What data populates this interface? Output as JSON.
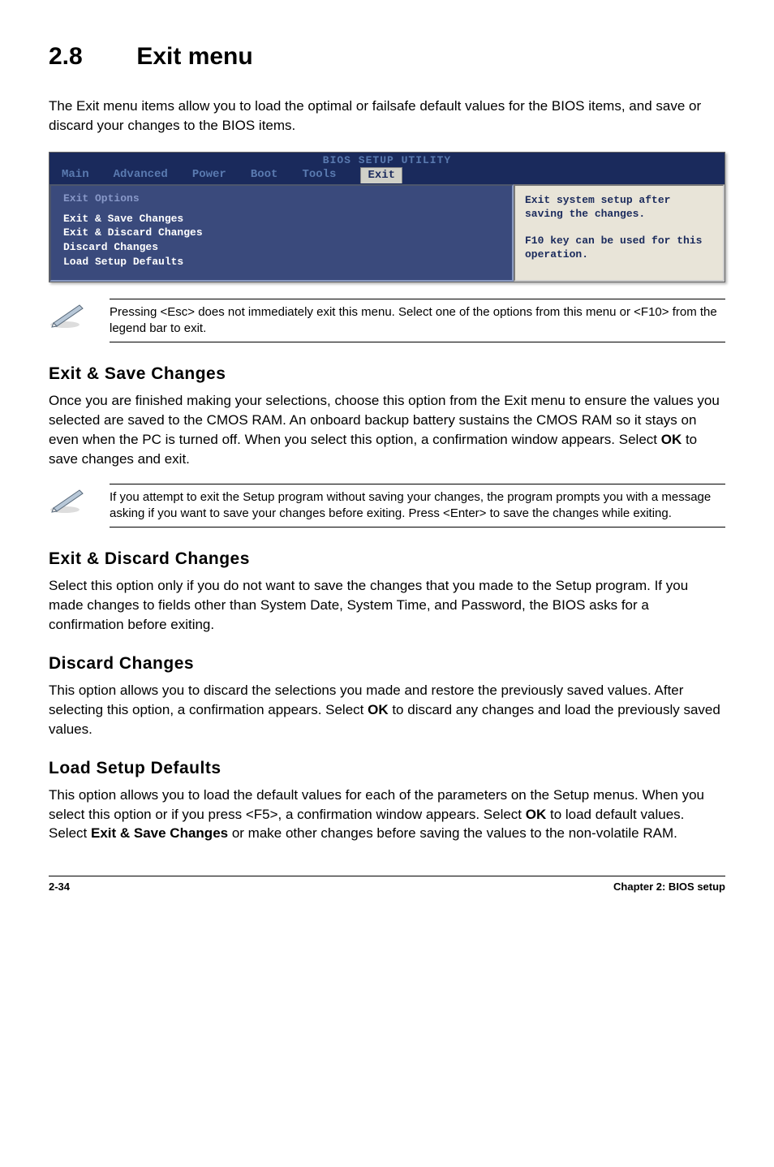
{
  "page": {
    "section_number": "2.8",
    "section_title": "Exit menu",
    "intro": "The Exit menu items allow you to load the optimal or failsafe default values for the BIOS items, and save or discard your changes to the BIOS items."
  },
  "bios": {
    "title": "BIOS SETUP UTILITY",
    "tabs": [
      "Main",
      "Advanced",
      "Power",
      "Boot",
      "Tools",
      "Exit"
    ],
    "left_heading": "Exit Options",
    "left_items": [
      "Exit & Save Changes",
      "Exit & Discard Changes",
      "Discard Changes",
      "",
      "Load Setup Defaults"
    ],
    "right_lines": "Exit system setup after saving the changes.\n\nF10 key can be used for this operation."
  },
  "note1": "Pressing <Esc> does not immediately exit this menu. Select one of the options from this menu or <F10> from the legend bar to exit.",
  "sections": {
    "s1": {
      "heading": "Exit & Save Changes",
      "body_pre": "Once you are finished making your selections, choose this option from the Exit menu to ensure the values you selected are saved to the CMOS RAM. An onboard backup battery sustains the CMOS RAM so it stays on even when the PC is turned off. When you select this option, a confirmation window appears. Select ",
      "body_bold1": "OK",
      "body_post": " to save changes and exit."
    },
    "note2": " If you attempt to exit the Setup program without saving your changes, the program prompts you with a message asking if you want to save your changes before exiting. Press <Enter>  to save the  changes while exiting.",
    "s2": {
      "heading": "Exit & Discard Changes",
      "body": "Select this option only if you do not want to save the changes that you made to the Setup program. If you made changes to fields other than System Date, System Time, and Password, the BIOS asks for a confirmation before exiting."
    },
    "s3": {
      "heading": "Discard Changes",
      "body_pre": "This option allows you to discard the selections you made and restore the previously saved values. After selecting this option, a confirmation appears. Select ",
      "body_bold": "OK",
      "body_post": " to discard any changes and load the previously saved values."
    },
    "s4": {
      "heading": "Load Setup Defaults",
      "body_pre": "This option allows you to load the default values for each of the parameters on the Setup menus. When you select this option or if you press <F5>, a confirmation window appears. Select ",
      "body_bold1": "OK",
      "body_mid": " to load default values. Select ",
      "body_bold2": "Exit & Save Changes",
      "body_post": " or make other changes before saving the values to the non-volatile RAM."
    }
  },
  "footer": {
    "left": "2-34",
    "right": "Chapter 2: BIOS setup"
  }
}
